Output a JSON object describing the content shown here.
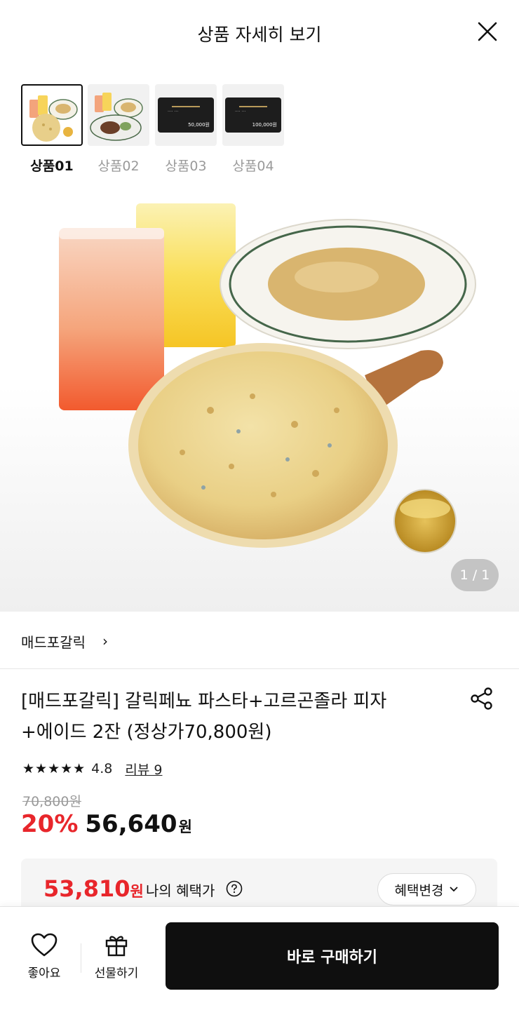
{
  "header": {
    "title": "상품 자세히 보기"
  },
  "thumbnails": [
    {
      "label": "상품01",
      "active": true
    },
    {
      "label": "상품02",
      "active": false
    },
    {
      "label": "상품03",
      "active": false,
      "card_amount": "50,000원"
    },
    {
      "label": "상품04",
      "active": false,
      "card_amount": "100,000원"
    }
  ],
  "gallery": {
    "counter": "1 / 1"
  },
  "brand": {
    "name": "매드포갈릭",
    "chevron": "›"
  },
  "product": {
    "title_line1": "[매드포갈릭] 갈릭페뇨 파스타+고르곤졸라 피자",
    "title_line2": "+에이드 2잔 (정상가70,800원)",
    "stars": "★★★★★",
    "rating": "4.8",
    "review_link": "리뷰 9",
    "original_price": "70,800원",
    "discount_rate": "20%",
    "sale_price": "56,640",
    "currency": "원"
  },
  "benefit": {
    "price": "53,810",
    "currency": "원",
    "label": "나의 혜택가",
    "change_button": "혜택변경"
  },
  "bottom_bar": {
    "like_label": "좋아요",
    "gift_label": "선물하기",
    "buy_label": "바로 구매하기"
  },
  "colors": {
    "accent_red": "#e8262b",
    "buy_button": "#0f0f0f"
  }
}
